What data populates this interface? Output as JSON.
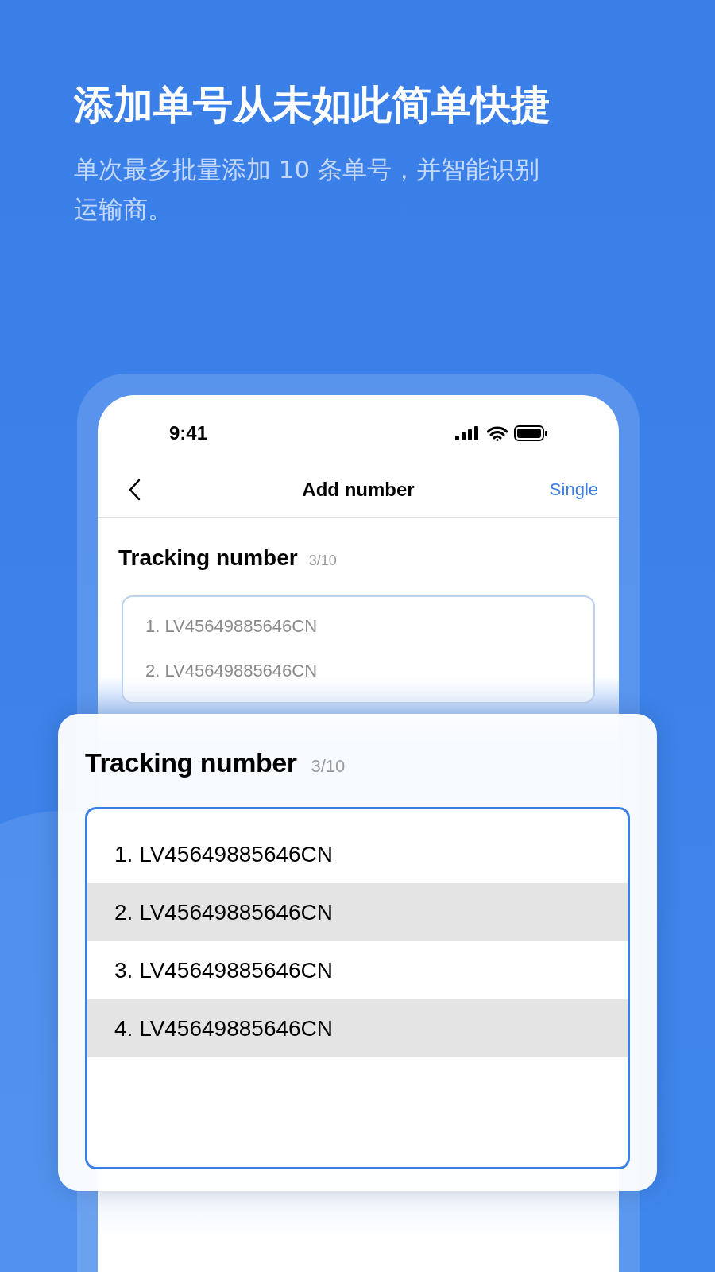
{
  "headline": "添加单号从未如此简单快捷",
  "subheadline": "单次最多批量添加 10 条单号，并智能识别运输商。",
  "phone": {
    "time": "9:41",
    "title": "Add number",
    "action": "Single",
    "label": "Tracking number",
    "count": "3/10",
    "lines": [
      "1. LV45649885646CN",
      "2. LV45649885646CN"
    ]
  },
  "card": {
    "label": "Tracking number",
    "count": "3/10",
    "rows": [
      {
        "text": "1. LV45649885646CN",
        "shaded": false
      },
      {
        "text": "2. LV45649885646CN",
        "shaded": true
      },
      {
        "text": "3. LV45649885646CN",
        "shaded": false
      },
      {
        "text": "4. LV45649885646CN",
        "shaded": true
      }
    ]
  }
}
